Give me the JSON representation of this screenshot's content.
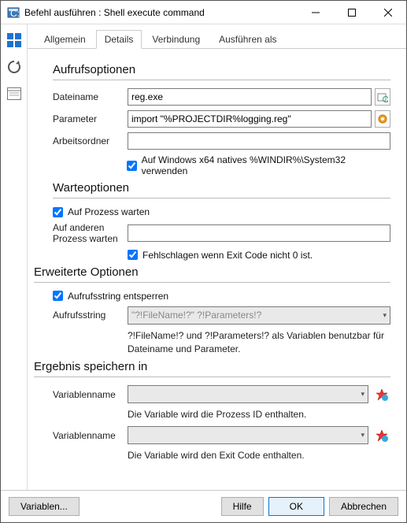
{
  "window": {
    "title": "Befehl ausführen : Shell execute command"
  },
  "tabs": {
    "general": "Allgemein",
    "details": "Details",
    "connection": "Verbindung",
    "run_as": "Ausführen als"
  },
  "call": {
    "heading": "Aufrufsoptionen",
    "filename_label": "Dateiname",
    "filename_value": "reg.exe",
    "params_label": "Parameter",
    "params_value": "import \"%PROJECTDIR%logging.reg\"",
    "workdir_label": "Arbeitsordner",
    "workdir_value": "",
    "x64_label": "Auf Windows x64 natives %WINDIR%\\System32 verwenden"
  },
  "wait": {
    "heading": "Warteoptionen",
    "wait_process_label": "Auf Prozess warten",
    "wait_other_label": "Auf anderen Prozess warten",
    "wait_other_value": "",
    "fail_label": "Fehlschlagen wenn Exit Code nicht 0 ist."
  },
  "adv": {
    "heading": "Erweiterte Optionen",
    "unlock_label": "Aufrufsstring entsperren",
    "callstring_label": "Aufrufsstring",
    "callstring_value": "\"?!FileName!?\" ?!Parameters!?",
    "hint": "?!FileName!? und ?!Parameters!? als Variablen benutzbar für Dateiname und Parameter."
  },
  "result": {
    "heading": "Ergebnis speichern in",
    "var_label": "Variablenname",
    "note1": "Die Variable wird die Prozess ID enthalten.",
    "note2": "Die Variable wird den Exit Code enthalten."
  },
  "footer": {
    "variables": "Variablen...",
    "help": "Hilfe",
    "ok": "OK",
    "cancel": "Abbrechen"
  }
}
